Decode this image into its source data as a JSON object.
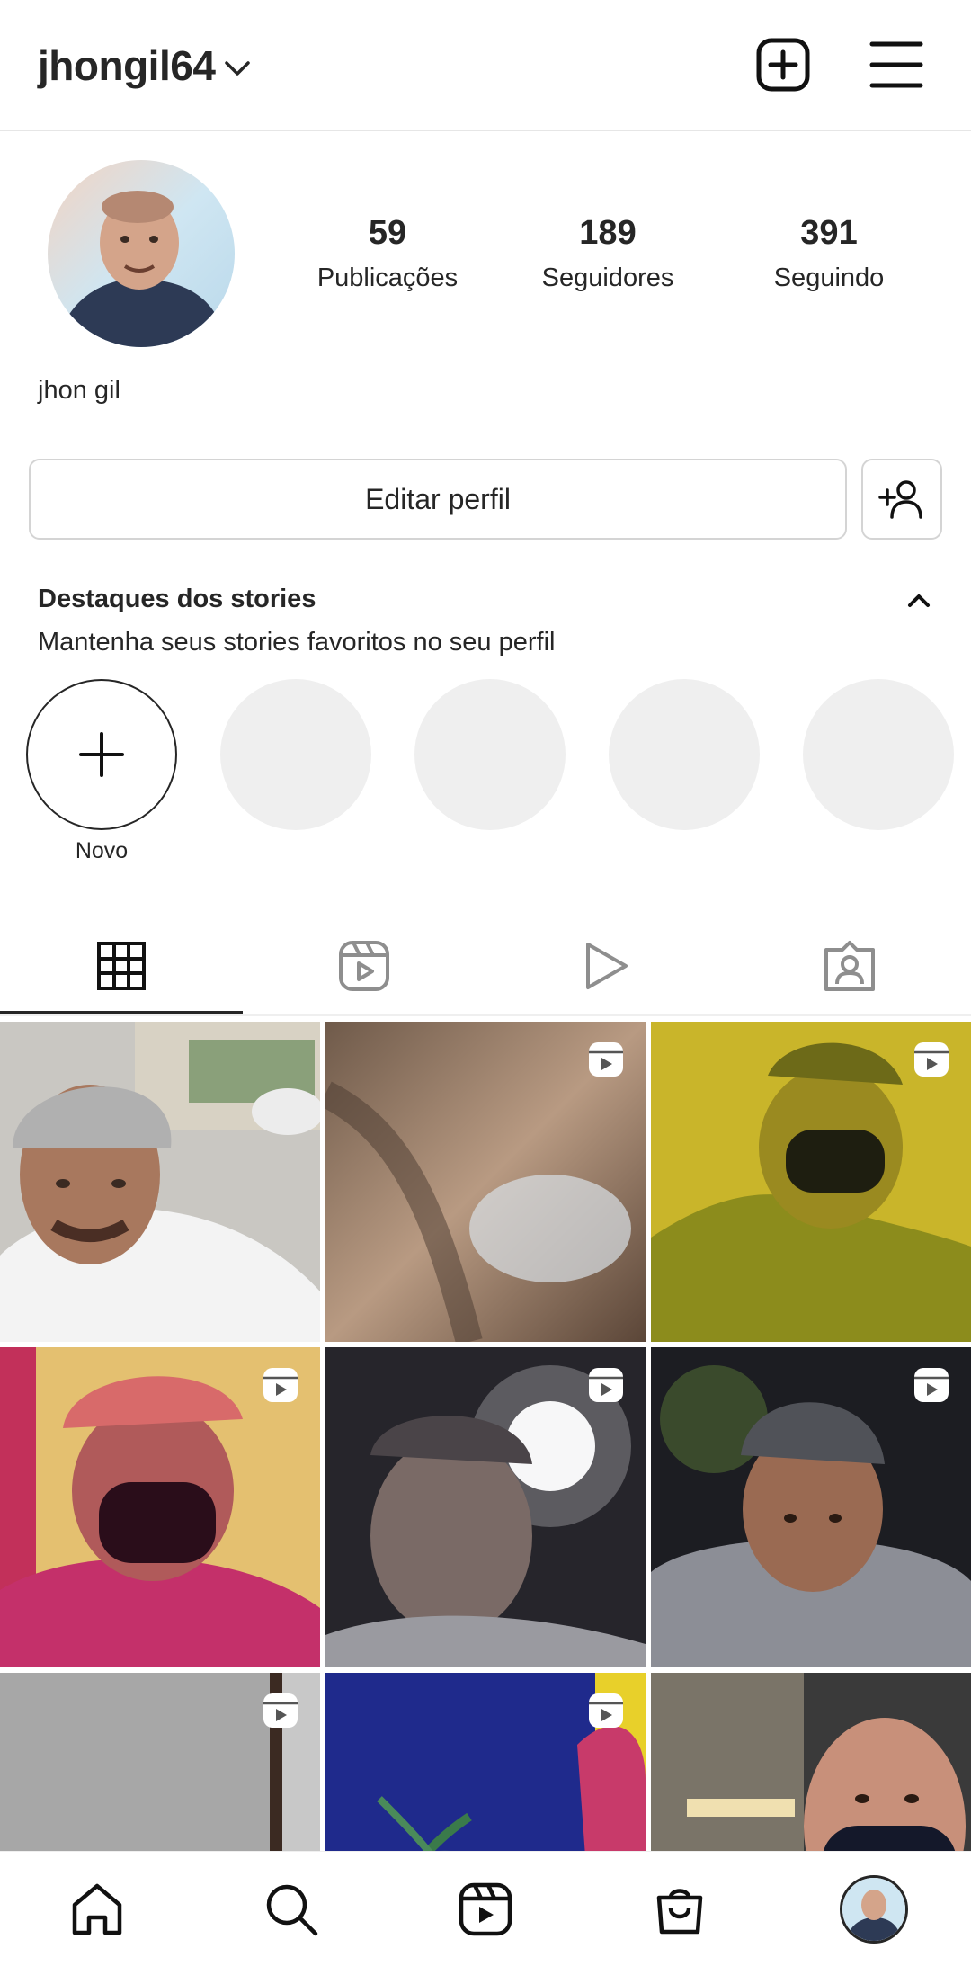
{
  "header": {
    "username": "jhongil64",
    "icons": [
      "chevron-down-icon",
      "new-post-icon",
      "menu-icon"
    ]
  },
  "profile": {
    "full_name": "jhon gil",
    "stats": [
      {
        "value": "59",
        "label": "Publicações"
      },
      {
        "value": "189",
        "label": "Seguidores"
      },
      {
        "value": "391",
        "label": "Seguindo"
      }
    ],
    "edit_button": "Editar perfil",
    "add_user_icon": "add-user-icon"
  },
  "highlights": {
    "title": "Destaques dos stories",
    "subtitle": "Mantenha seus stories favoritos no seu perfil",
    "new_label": "Novo"
  },
  "tabs": [
    {
      "icon": "grid-icon",
      "active": true
    },
    {
      "icon": "reels-icon",
      "active": false
    },
    {
      "icon": "video-play-icon",
      "active": false
    },
    {
      "icon": "tagged-icon",
      "active": false
    }
  ],
  "grid_posts": [
    {
      "type": "photo"
    },
    {
      "type": "reel"
    },
    {
      "type": "reel"
    },
    {
      "type": "reel"
    },
    {
      "type": "reel"
    },
    {
      "type": "reel"
    },
    {
      "type": "reel"
    },
    {
      "type": "reel"
    },
    {
      "type": "photo"
    }
  ],
  "bottom_nav": [
    "home-icon",
    "search-icon",
    "reels-icon",
    "shop-icon",
    "profile-avatar"
  ],
  "colors": {
    "text": "#262626",
    "divider": "#e6e6e6",
    "placeholder": "#efefef"
  }
}
